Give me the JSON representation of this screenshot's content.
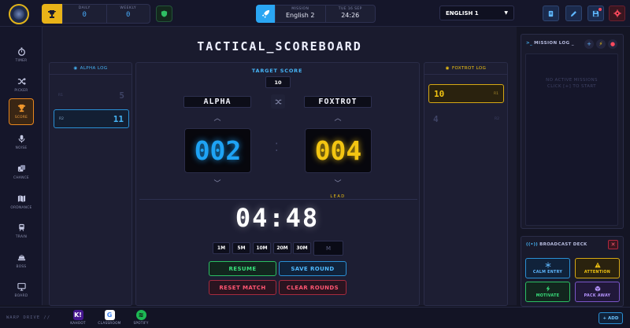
{
  "header": {
    "stats": {
      "daily_label": "DAILY",
      "daily_value": "0",
      "weekly_label": "WEEKLY",
      "weekly_value": "0"
    },
    "mission": {
      "mission_label": "MISSION",
      "mission_value": "English 2",
      "date_label": "TUE 16 SEP",
      "time_value": "24:26"
    },
    "language_select": "ENGLISH 1"
  },
  "rail": {
    "items": [
      {
        "label": "TIMER",
        "icon": "stopwatch-icon"
      },
      {
        "label": "PICKER",
        "icon": "shuffle-icon"
      },
      {
        "label": "SCORE",
        "icon": "trophy-icon"
      },
      {
        "label": "NOISE",
        "icon": "microphone-icon"
      },
      {
        "label": "CHANCE",
        "icon": "dice-icon"
      },
      {
        "label": "ORDNANCE",
        "icon": "map-icon"
      },
      {
        "label": "TRAIN",
        "icon": "train-icon"
      },
      {
        "label": "BOSS",
        "icon": "boss-icon"
      },
      {
        "label": "BOARD",
        "icon": "monitor-icon"
      }
    ]
  },
  "scoreboard": {
    "title": "TACTICAL_SCOREBOARD",
    "target_label": "TARGET SCORE",
    "target_value": "10",
    "team_a": "ALPHA",
    "team_b": "FOXTROT",
    "score_a": "002",
    "score_b": "004",
    "lead_label": "LEAD",
    "timer": "04:48",
    "presets": [
      "1M",
      "5M",
      "10M",
      "20M",
      "30M"
    ],
    "custom_placeholder": "M",
    "actions": {
      "resume": "RESUME",
      "save": "SAVE ROUND",
      "reset": "RESET MATCH",
      "clear": "CLEAR ROUNDS"
    }
  },
  "alpha_log": {
    "title": "ALPHA LOG",
    "rows": [
      {
        "tag": "R1",
        "value": "5"
      },
      {
        "tag": "R2",
        "value": "11"
      }
    ]
  },
  "foxtrot_log": {
    "title": "FOXTROT LOG",
    "rows": [
      {
        "tag": "R1",
        "value": "10"
      },
      {
        "tag": "R2",
        "value": "4"
      }
    ]
  },
  "mission_log": {
    "title": "MISSION LOG _",
    "empty_line1": "NO ACTIVE MISSIONS",
    "empty_line2": "CLICK [+] TO START"
  },
  "broadcast": {
    "title": "BROADCAST DECK",
    "buttons": [
      {
        "label": "CALM ENTRY",
        "icon": "snowflake-icon"
      },
      {
        "label": "ATTENTION",
        "icon": "warning-icon"
      },
      {
        "label": "MOTIVATE",
        "icon": "bolt-icon"
      },
      {
        "label": "PACK AWAY",
        "icon": "box-icon"
      }
    ]
  },
  "footer": {
    "warp_label": "WARP DRIVE //",
    "apps": [
      {
        "label": "KAHOOT",
        "glyph": "K!"
      },
      {
        "label": "CLASSROOM",
        "glyph": "G"
      },
      {
        "label": "SPOTIFY",
        "glyph": "≋"
      }
    ],
    "add_label": "+ ADD"
  },
  "colors": {
    "alpha": "#1ea3f5",
    "foxtrot": "#f3c512",
    "accent_orange": "#e8861e",
    "go": "#39e07c",
    "danger": "#ff5571"
  }
}
